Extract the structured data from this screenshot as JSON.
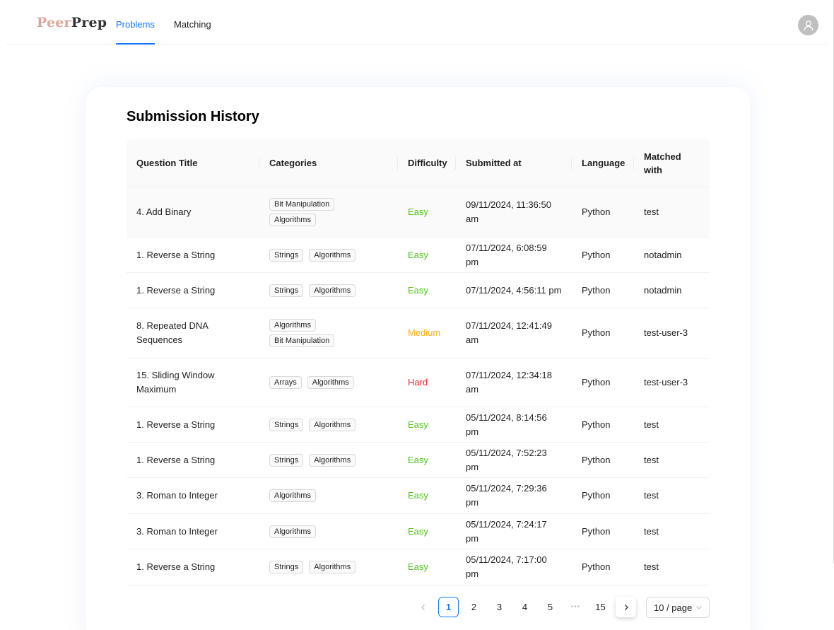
{
  "header": {
    "logo_peer": "Peer",
    "logo_prep": "Prep",
    "nav": [
      {
        "label": "Problems",
        "active": true
      },
      {
        "label": "Matching",
        "active": false
      }
    ],
    "avatar_icon": "user-icon"
  },
  "main": {
    "title": "Submission History",
    "columns": [
      "Question Title",
      "Categories",
      "Difficulty",
      "Submitted at",
      "Language",
      "Matched with"
    ],
    "rows": [
      {
        "title": "4. Add Binary",
        "categories": [
          "Bit Manipulation",
          "Algorithms"
        ],
        "difficulty": "Easy",
        "submitted_at": "09/11/2024, 11:36:50 am",
        "language": "Python",
        "matched_with": "test"
      },
      {
        "title": "1. Reverse a String",
        "categories": [
          "Strings",
          "Algorithms"
        ],
        "difficulty": "Easy",
        "submitted_at": "07/11/2024, 6:08:59 pm",
        "language": "Python",
        "matched_with": "notadmin"
      },
      {
        "title": "1. Reverse a String",
        "categories": [
          "Strings",
          "Algorithms"
        ],
        "difficulty": "Easy",
        "submitted_at": "07/11/2024, 4:56:11 pm",
        "language": "Python",
        "matched_with": "notadmin"
      },
      {
        "title": "8. Repeated DNA Sequences",
        "categories": [
          "Algorithms",
          "Bit Manipulation"
        ],
        "difficulty": "Medium",
        "submitted_at": "07/11/2024, 12:41:49 am",
        "language": "Python",
        "matched_with": "test-user-3"
      },
      {
        "title": "15. Sliding Window Maximum",
        "categories": [
          "Arrays",
          "Algorithms"
        ],
        "difficulty": "Hard",
        "submitted_at": "07/11/2024, 12:34:18 am",
        "language": "Python",
        "matched_with": "test-user-3"
      },
      {
        "title": "1. Reverse a String",
        "categories": [
          "Strings",
          "Algorithms"
        ],
        "difficulty": "Easy",
        "submitted_at": "05/11/2024, 8:14:56 pm",
        "language": "Python",
        "matched_with": "test"
      },
      {
        "title": "1. Reverse a String",
        "categories": [
          "Strings",
          "Algorithms"
        ],
        "difficulty": "Easy",
        "submitted_at": "05/11/2024, 7:52:23 pm",
        "language": "Python",
        "matched_with": "test"
      },
      {
        "title": "3. Roman to Integer",
        "categories": [
          "Algorithms"
        ],
        "difficulty": "Easy",
        "submitted_at": "05/11/2024, 7:29:36 pm",
        "language": "Python",
        "matched_with": "test"
      },
      {
        "title": "3. Roman to Integer",
        "categories": [
          "Algorithms"
        ],
        "difficulty": "Easy",
        "submitted_at": "05/11/2024, 7:24:17 pm",
        "language": "Python",
        "matched_with": "test"
      },
      {
        "title": "1. Reverse a String",
        "categories": [
          "Strings",
          "Algorithms"
        ],
        "difficulty": "Easy",
        "submitted_at": "05/11/2024, 7:17:00 pm",
        "language": "Python",
        "matched_with": "test"
      }
    ],
    "difficulty_colors": {
      "Easy": "#52c41a",
      "Medium": "#faad14",
      "Hard": "#f5222d"
    }
  },
  "pagination": {
    "prev_icon": "chevron-left-icon",
    "pages": [
      "1",
      "2",
      "3",
      "4",
      "5"
    ],
    "current": "1",
    "ellipsis": "•••",
    "last_page": "15",
    "next_icon": "chevron-right-icon",
    "page_size": "10 / page",
    "page_size_icon": "chevron-down-icon"
  },
  "colors": {
    "accent": "#1677ff"
  }
}
